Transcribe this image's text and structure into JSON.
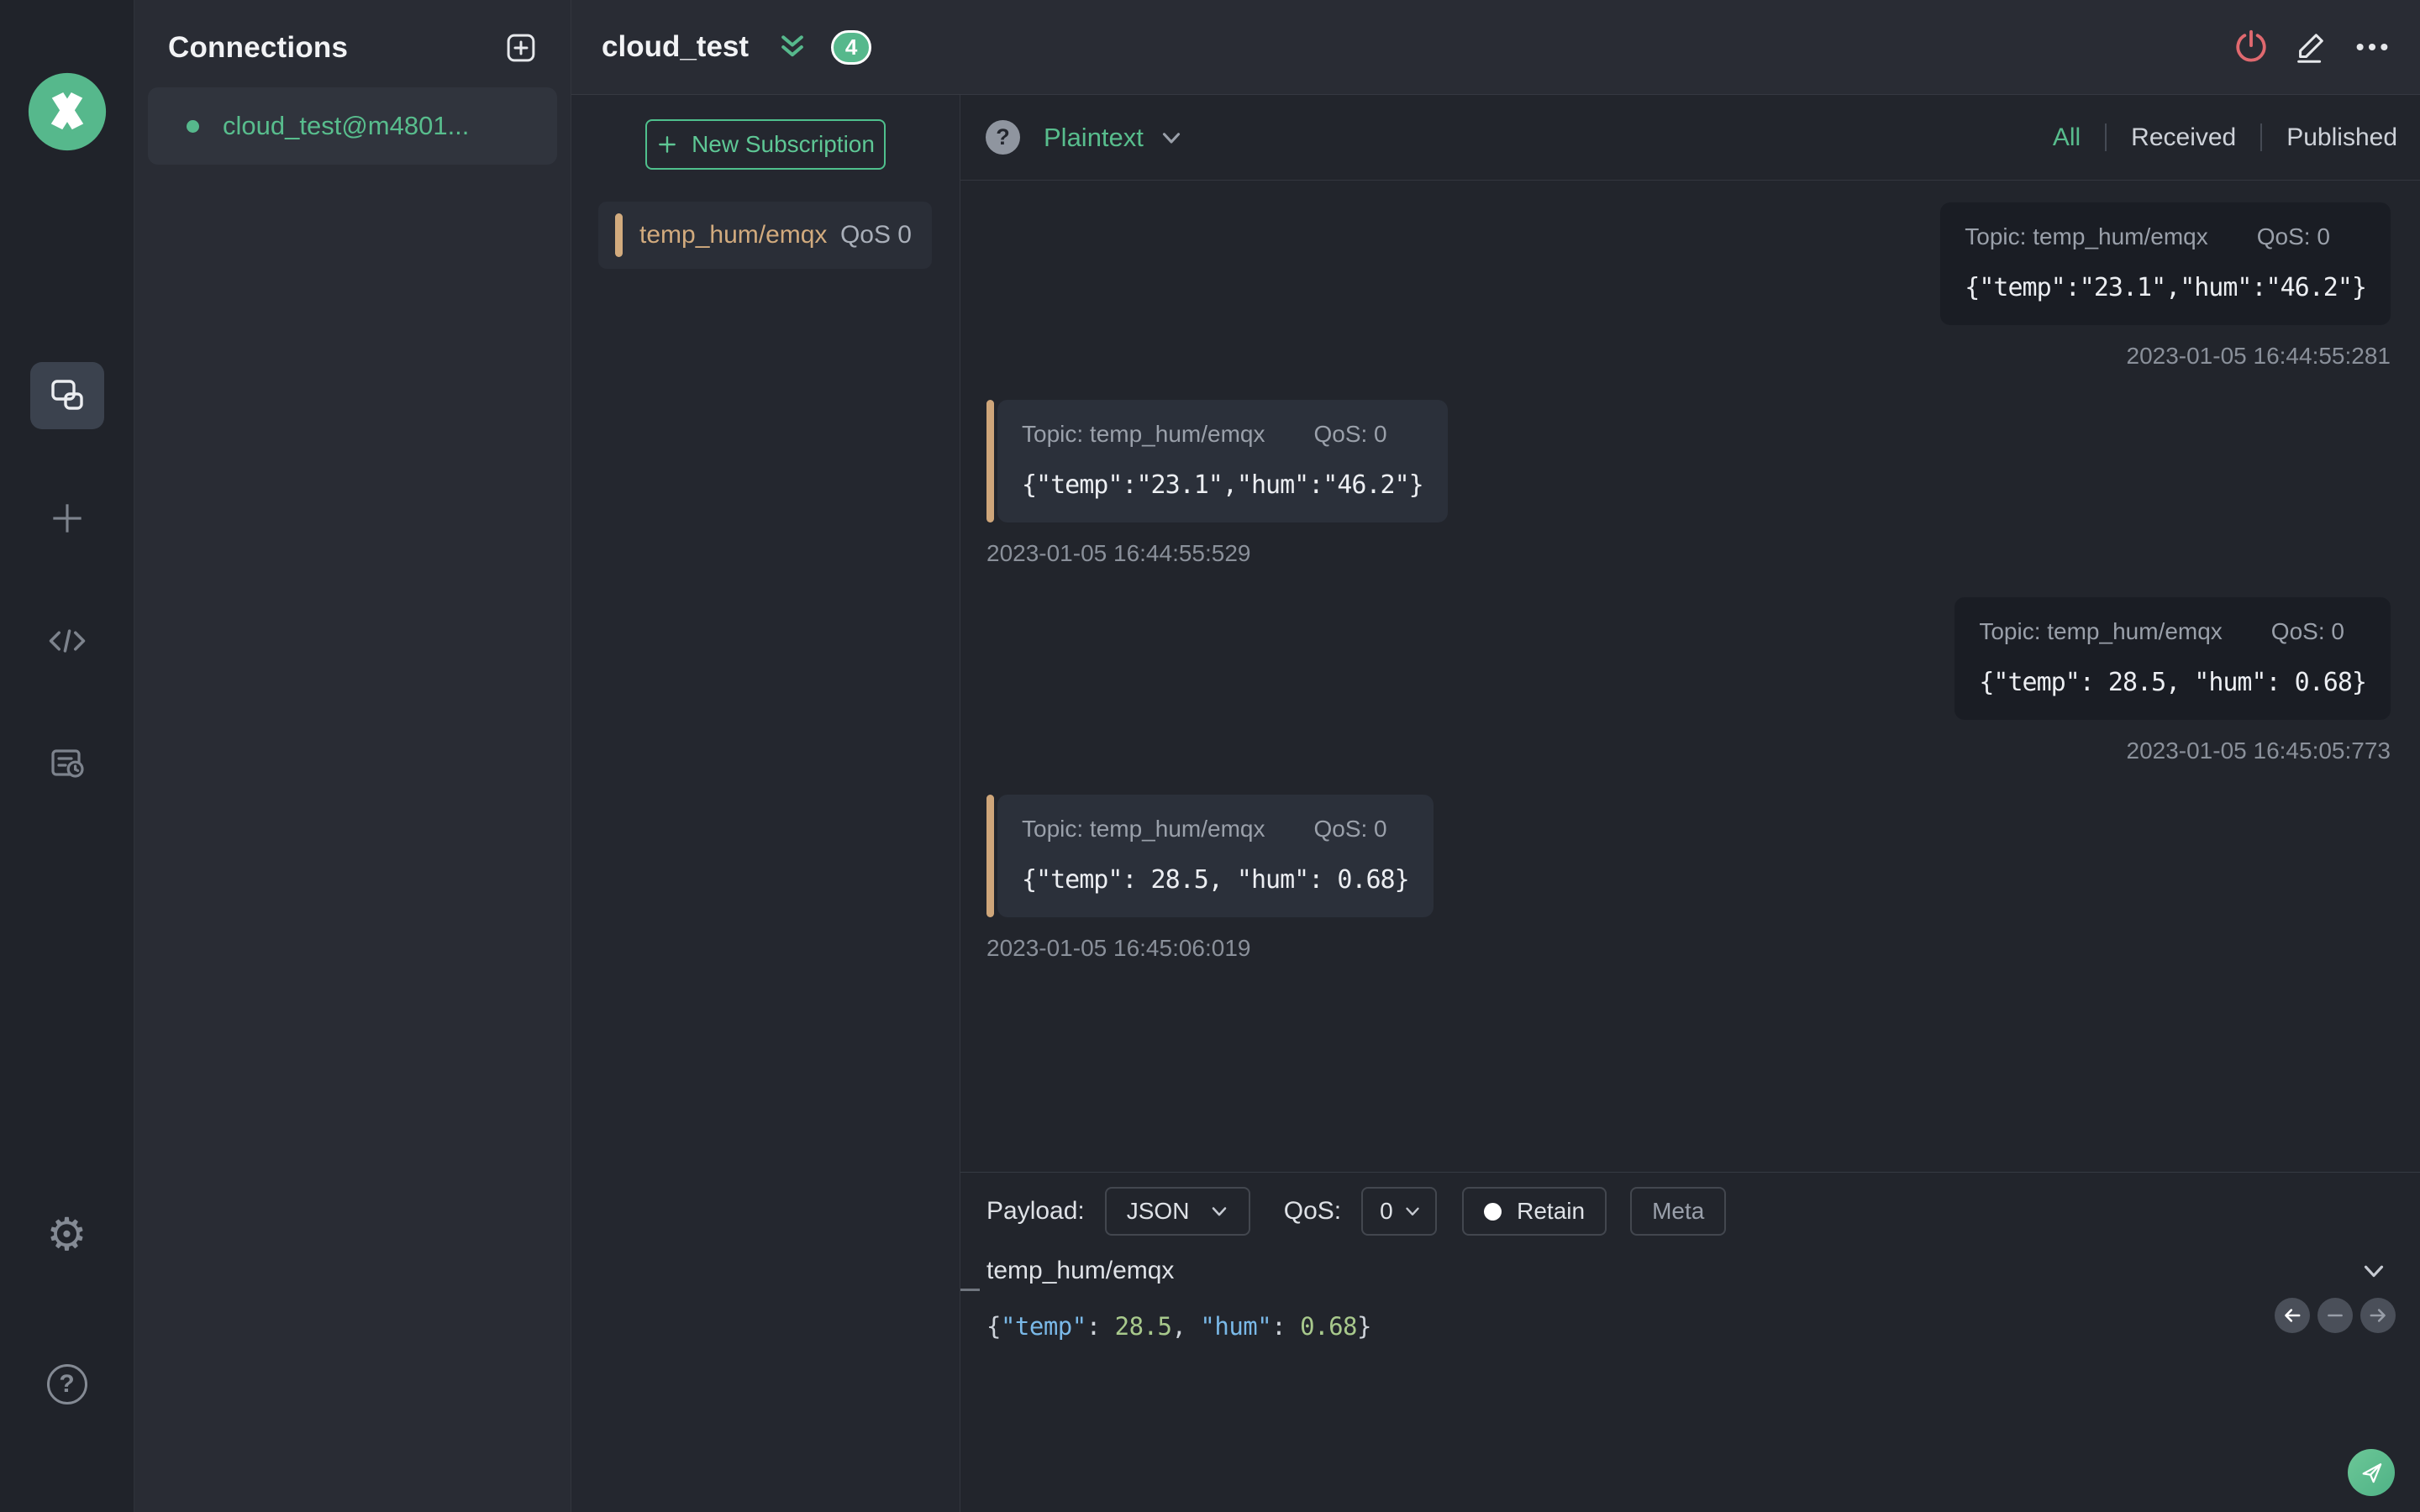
{
  "colors": {
    "accent_green": "#56b88c",
    "accent_orange": "#d2ab7e",
    "danger_red": "#e0696f"
  },
  "sidebar": {
    "nav_icons": [
      "connections-icon",
      "new-connection-icon",
      "script-icon",
      "log-icon"
    ],
    "active_nav": "connections-icon",
    "bottom_icons": [
      "settings-icon",
      "help-icon"
    ]
  },
  "connections": {
    "title": "Connections",
    "items": [
      {
        "label": "cloud_test@m4801...",
        "connected": true
      }
    ]
  },
  "header": {
    "connection_name": "cloud_test",
    "message_count_badge": "4"
  },
  "subscriptions": {
    "new_subscription_label": "New Subscription",
    "items": [
      {
        "topic": "temp_hum/emqx",
        "qos": "QoS 0"
      }
    ]
  },
  "messages": {
    "format": "Plaintext",
    "filters": [
      "All",
      "Received",
      "Published"
    ],
    "active_filter": "All",
    "items": [
      {
        "direction": "published",
        "topic": "Topic: temp_hum/emqx",
        "qos": "QoS: 0",
        "payload": "{\"temp\":\"23.1\",\"hum\":\"46.2\"}",
        "timestamp": "2023-01-05 16:44:55:281"
      },
      {
        "direction": "received",
        "topic": "Topic: temp_hum/emqx",
        "qos": "QoS: 0",
        "payload": "{\"temp\":\"23.1\",\"hum\":\"46.2\"}",
        "timestamp": "2023-01-05 16:44:55:529"
      },
      {
        "direction": "published",
        "topic": "Topic: temp_hum/emqx",
        "qos": "QoS: 0",
        "payload": "{\"temp\": 28.5, \"hum\": 0.68}",
        "timestamp": "2023-01-05 16:45:05:773"
      },
      {
        "direction": "received",
        "topic": "Topic: temp_hum/emqx",
        "qos": "QoS: 0",
        "payload": "{\"temp\": 28.5, \"hum\": 0.68}",
        "timestamp": "2023-01-05 16:45:06:019"
      }
    ]
  },
  "publish": {
    "payload_label": "Payload:",
    "payload_format": "JSON",
    "qos_label": "QoS:",
    "qos_value": "0",
    "retain_label": "Retain",
    "meta_label": "Meta",
    "topic": "temp_hum/emqx",
    "payload_tokens": [
      {
        "text": "{",
        "type": "punct"
      },
      {
        "text": "\"temp\"",
        "type": "key"
      },
      {
        "text": ": ",
        "type": "punct"
      },
      {
        "text": "28.5",
        "type": "num"
      },
      {
        "text": ", ",
        "type": "punct"
      },
      {
        "text": "\"hum\"",
        "type": "key"
      },
      {
        "text": ": ",
        "type": "punct"
      },
      {
        "text": "0.68",
        "type": "num"
      },
      {
        "text": "}",
        "type": "punct"
      }
    ]
  }
}
